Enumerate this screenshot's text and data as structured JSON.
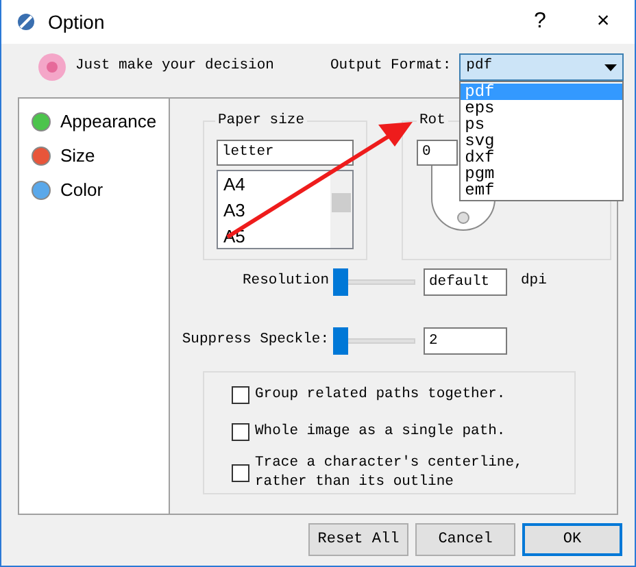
{
  "window": {
    "title": "Option",
    "buttons": [
      "?",
      "×"
    ]
  },
  "header": {
    "message": "Just make your decision",
    "output_label": "Output Format:",
    "output_value": "pdf",
    "dropdown_open": true,
    "options": [
      {
        "label": "pdf",
        "selected": true
      },
      {
        "label": "eps",
        "selected": false
      },
      {
        "label": "ps",
        "selected": false
      },
      {
        "label": "svg",
        "selected": false
      },
      {
        "label": "dxf",
        "selected": false
      },
      {
        "label": "pgm",
        "selected": false
      },
      {
        "label": "emf",
        "selected": false
      }
    ]
  },
  "sidebar": {
    "items": [
      {
        "label": "Appearance",
        "color": "#4cc44c"
      },
      {
        "label": "Size",
        "color": "#e8553a"
      },
      {
        "label": "Color",
        "color": "#5aa8ea"
      }
    ]
  },
  "paper": {
    "title": "Paper size",
    "value": "letter",
    "items": [
      "A4",
      "A3",
      "A5"
    ]
  },
  "rotation": {
    "title": "Rot",
    "value": "0"
  },
  "sliders": [
    {
      "label": "Resolution",
      "level": 0,
      "value": "default",
      "unit": "dpi"
    },
    {
      "label": "Suppress Speckle:",
      "level": 0,
      "value": "2"
    }
  ],
  "checks": [
    {
      "label": "Group related paths together.",
      "checked": false
    },
    {
      "label": "Whole image as a single path.",
      "checked": false
    },
    {
      "label": "Trace a character's centerline,\nrather than its outline",
      "checked": false
    }
  ],
  "buttons": [
    {
      "label": "Reset All",
      "default": false
    },
    {
      "label": "Cancel",
      "default": false
    },
    {
      "label": "OK",
      "default": true
    }
  ]
}
